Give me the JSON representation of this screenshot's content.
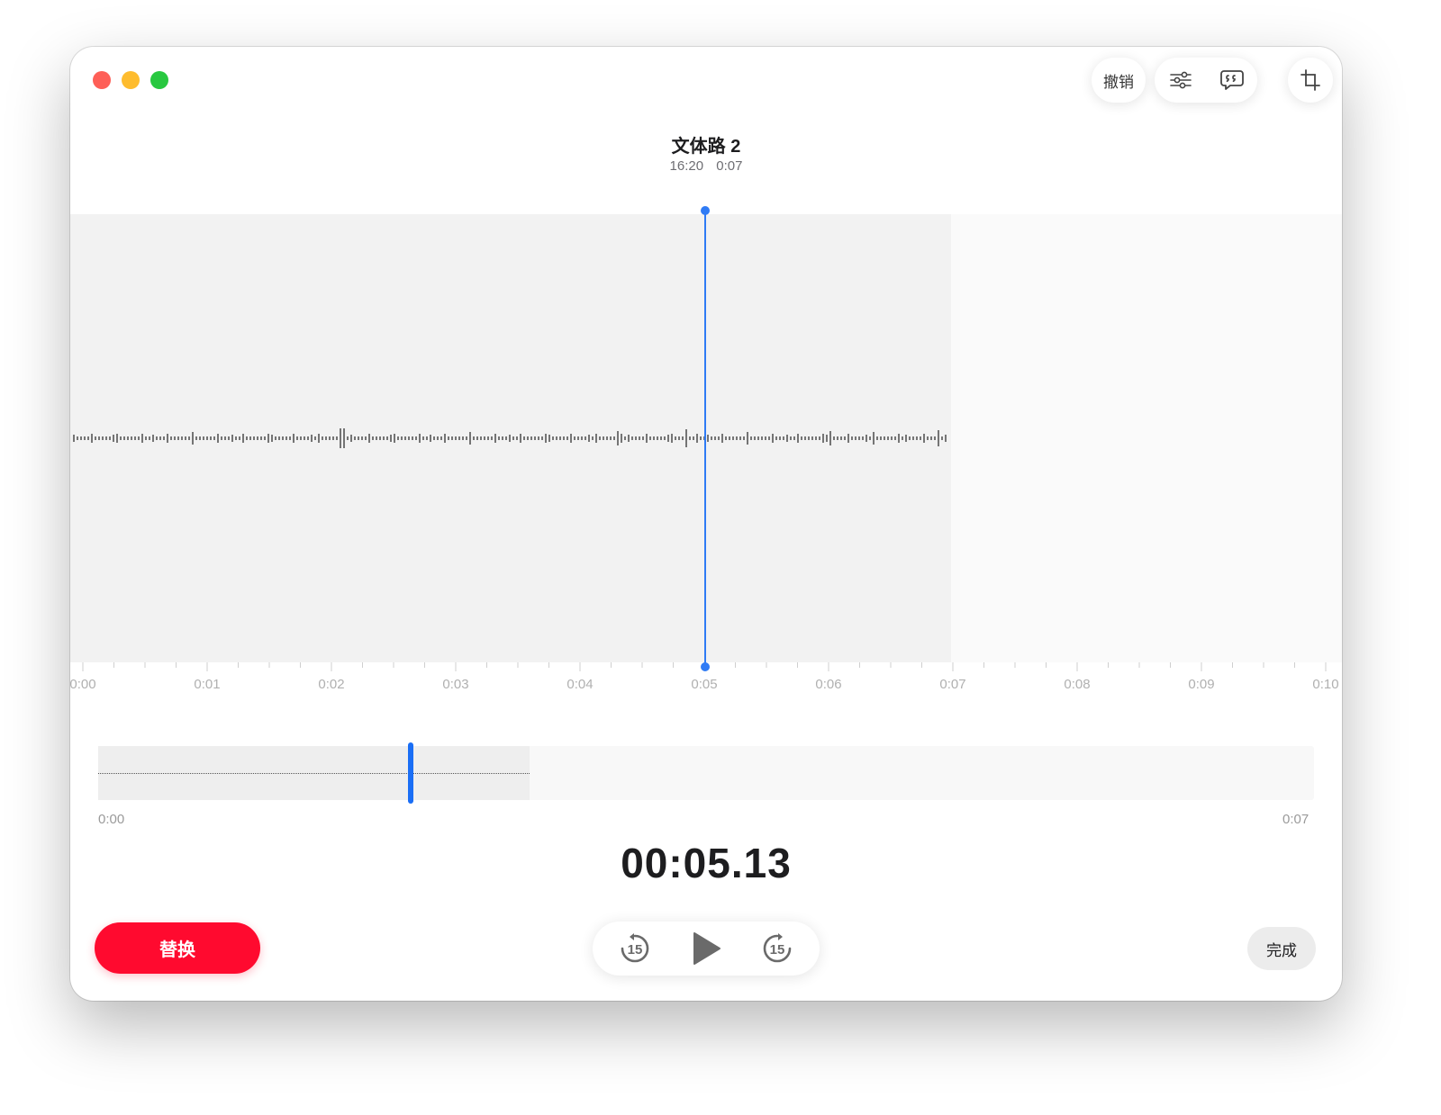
{
  "window_controls": [
    "close",
    "minimize",
    "zoom"
  ],
  "toolbar": {
    "undo_label": "撤销",
    "icons": [
      "sliders-icon",
      "transcript-bubble-icon",
      "crop-icon"
    ]
  },
  "recording": {
    "title": "文体路 2",
    "time": "16:20",
    "duration": "0:07"
  },
  "timeline": {
    "ticks": [
      "0:00",
      "0:01",
      "0:02",
      "0:03",
      "0:04",
      "0:05",
      "0:06",
      "0:07",
      "0:08",
      "0:09",
      "0:10"
    ]
  },
  "overview": {
    "start_label": "0:00",
    "end_label": "0:07"
  },
  "playback": {
    "current_time": "00:05.13",
    "skip_back_label": "15",
    "skip_forward_label": "15"
  },
  "buttons": {
    "replace": "替换",
    "done": "完成"
  },
  "colors": {
    "accent": "#2f7bf5",
    "record_red": "#ff0a2f"
  }
}
